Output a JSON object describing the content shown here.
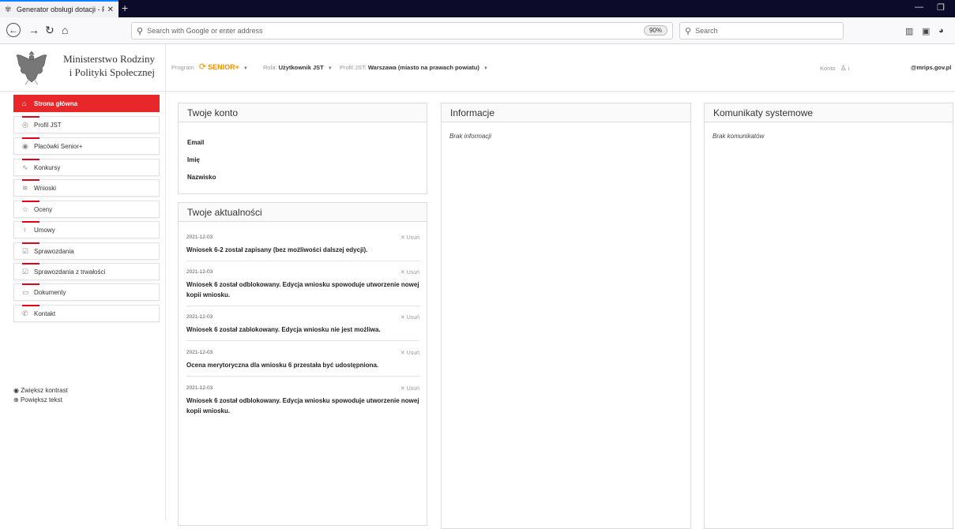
{
  "browser": {
    "tab_title": "Generator obsługi dotacji - Pa",
    "url_placeholder": "Search with Google or enter address",
    "zoom": "90%",
    "search_placeholder": "Search"
  },
  "header": {
    "ministry_line1": "Ministerstwo Rodziny",
    "ministry_line2": "i Polityki Społecznej",
    "program_label": "Program",
    "program_value": "SENIOR+",
    "role_label": "Rola:",
    "role_value": "Użytkownik JST",
    "profile_label": "Profil JST:",
    "profile_value": "Warszawa (miasto na prawach powiatu)",
    "account_label": "Konto",
    "account_value": "i",
    "email": "@mrips.gov.pl"
  },
  "sidebar": {
    "items": [
      {
        "label": "Strona główna",
        "icon": "⌂"
      },
      {
        "label": "Profil JST",
        "icon": "◎"
      },
      {
        "label": "Placówki Senior+",
        "icon": "◉"
      },
      {
        "label": "Konkursy",
        "icon": "∿"
      },
      {
        "label": "Wnioski",
        "icon": "≋"
      },
      {
        "label": "Oceny",
        "icon": "☆"
      },
      {
        "label": "Umowy",
        "icon": "♀"
      },
      {
        "label": "Sprawozdania",
        "icon": "☑"
      },
      {
        "label": "Sprawozdania z trwałości",
        "icon": "☑"
      },
      {
        "label": "Dokumenty",
        "icon": "▭"
      },
      {
        "label": "Kontakt",
        "icon": "✆"
      }
    ],
    "contrast": "Zwiększ kontrast",
    "bigger_text": "Powiększ tekst"
  },
  "account_panel": {
    "title": "Twoje konto",
    "email": "Email",
    "first_name": "Imię",
    "last_name": "Nazwisko"
  },
  "news_panel": {
    "title": "Twoje aktualności",
    "remove_label": "Usuń",
    "items": [
      {
        "date": "2021-12-03",
        "text": "Wniosek 6-2 został zapisany (bez możliwości dalszej edycji)."
      },
      {
        "date": "2021-12-03",
        "text": "Wniosek 6 został odblokowany. Edycja wniosku spowoduje utworzenie nowej kopii wniosku."
      },
      {
        "date": "2021-12-03",
        "text": "Wniosek 6 został zablokowany. Edycja wniosku nie jest możliwa."
      },
      {
        "date": "2021-12-03",
        "text": "Ocena merytoryczna dla wniosku 6 przestała być udostępniona."
      },
      {
        "date": "2021-12-03",
        "text": "Wniosek 6 został odblokowany. Edycja wniosku spowoduje utworzenie nowej kopii wniosku."
      }
    ]
  },
  "info_panel": {
    "title": "Informacje",
    "empty": "Brak informacji"
  },
  "system_panel": {
    "title": "Komunikaty systemowe",
    "empty": "Brak komunikatów"
  },
  "colors": {
    "accent_red": "#e8272a",
    "senior_orange": "#f39200",
    "chrome_dark": "#0c0c2a"
  }
}
